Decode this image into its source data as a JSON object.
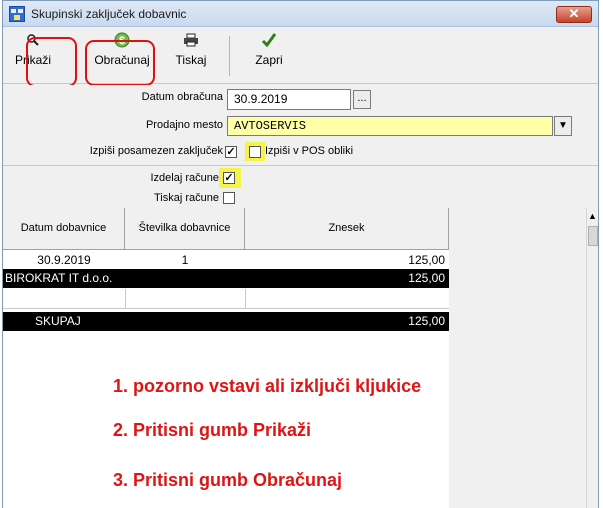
{
  "window": {
    "title": "Skupinski zaključek dobavnic",
    "close_glyph": "✕",
    "accent_color": "#e01010",
    "highlight_color": "#f6f44a"
  },
  "toolbar": {
    "show_label": "Prikaži",
    "calculate_label": "Obračunaj",
    "print_label": "Tiskaj",
    "close_label": "Zapri"
  },
  "form": {
    "date_label": "Datum obračuna",
    "date_value": "30.9.2019",
    "dots_label": "...",
    "location_label": "Prodajno mesto",
    "location_value": "AVTOSERVIS",
    "print_single_label": "Izpiši posamezen zaključek",
    "print_single_checked": true,
    "pos_form_label": "Izpiši v POS obliki",
    "pos_form_checked": false,
    "create_invoices_label": "Izdelaj račune",
    "create_invoices_checked": true,
    "print_invoices_label": "Tiskaj račune",
    "print_invoices_checked": false
  },
  "grid": {
    "columns": [
      "Datum dobavnice",
      "Številka dobavnice",
      "Znesek"
    ],
    "rows": [
      {
        "date": "30.9.2019",
        "number": "1",
        "amount": "125,00"
      }
    ],
    "group_row": {
      "name": "BIROKRAT IT d.o.o.",
      "amount": "125,00"
    },
    "total_row": {
      "label": "SKUPAJ",
      "amount": "125,00"
    }
  },
  "instructions": [
    "1.   pozorno vstavi ali izključi kljukice",
    "2.   Pritisni gumb Prikaži",
    "3.   Pritisni gumb Obračunaj"
  ]
}
